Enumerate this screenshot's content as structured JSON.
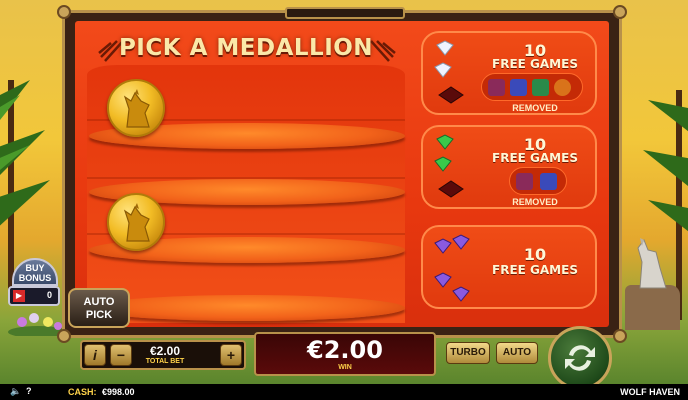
{
  "game": {
    "title": "WOLF HAVEN",
    "pick_title": "PICK A MEDALLION"
  },
  "prizes": [
    {
      "count": "10",
      "label": "FREE GAMES",
      "status": "REMOVED",
      "gems": "white",
      "removed_symbols": [
        "purple-bag-icon",
        "blue-feather-icon",
        "green-stone-icon",
        "orange-dreamcatcher-icon"
      ]
    },
    {
      "count": "10",
      "label": "FREE GAMES",
      "status": "REMOVED",
      "gems": "green",
      "removed_symbols": [
        "purple-bag-icon",
        "blue-feather-icon"
      ]
    },
    {
      "count": "10",
      "label": "FREE GAMES",
      "status": "",
      "gems": "purple",
      "removed_symbols": []
    }
  ],
  "controls": {
    "autopick_label": "AUTO\nPICK",
    "buy_bonus_label": "BUY\nBONUS",
    "buy_bonus_count": "0",
    "info_label": "i",
    "minus_label": "−",
    "plus_label": "+",
    "total_bet_value": "€2.00",
    "total_bet_label": "TOTAL BET",
    "win_value": "€2.00",
    "win_label": "WIN",
    "turbo_label": "TURBO",
    "auto_label": "AUTO"
  },
  "status_bar": {
    "cash_label": "CASH:",
    "cash_value": "€998.00",
    "sound_icon": "speaker-muted-icon",
    "help_icon": "help-icon",
    "game_name": "WOLF HAVEN"
  },
  "colors": {
    "panel_orange": "#e8380f",
    "gold": "#c9a45a",
    "spin_green": "#1f4a1a"
  }
}
